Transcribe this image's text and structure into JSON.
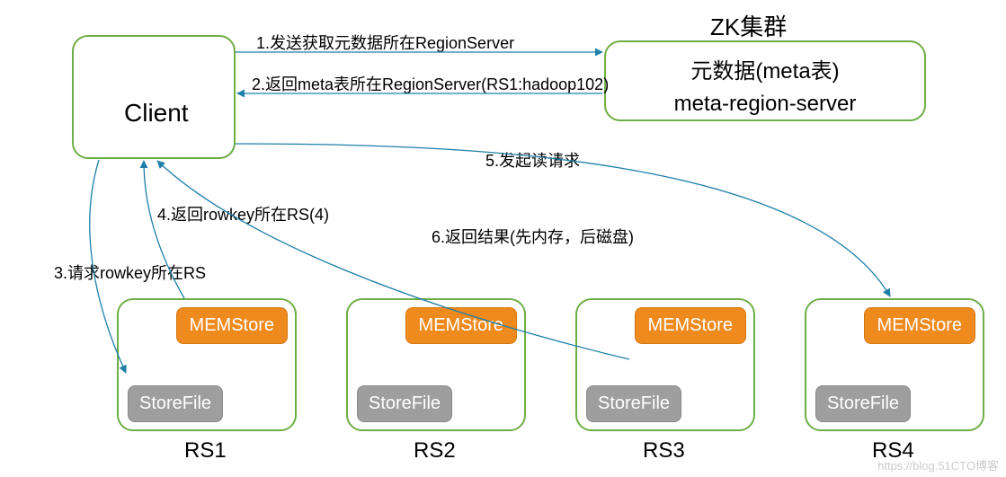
{
  "client": {
    "label": "Client"
  },
  "zk": {
    "title": "ZK集群",
    "line1": "元数据(meta表)",
    "line2": "meta-region-server"
  },
  "arrows": {
    "a1": "1.发送获取元数据所在RegionServer",
    "a2": "2.返回meta表所在RegionServer(RS1:hadoop102)",
    "a3": "3.请求rowkey所在RS",
    "a4": "4.返回rowkey所在RS(4)",
    "a5": "5.发起读请求",
    "a6": "6.返回结果(先内存，后磁盘)"
  },
  "rs_common": {
    "mem": "MEMStore",
    "store": "StoreFile"
  },
  "rs": [
    {
      "name": "RS1"
    },
    {
      "name": "RS2"
    },
    {
      "name": "RS3"
    },
    {
      "name": "RS4"
    }
  ],
  "watermark": "https://blog.51CTO博客"
}
